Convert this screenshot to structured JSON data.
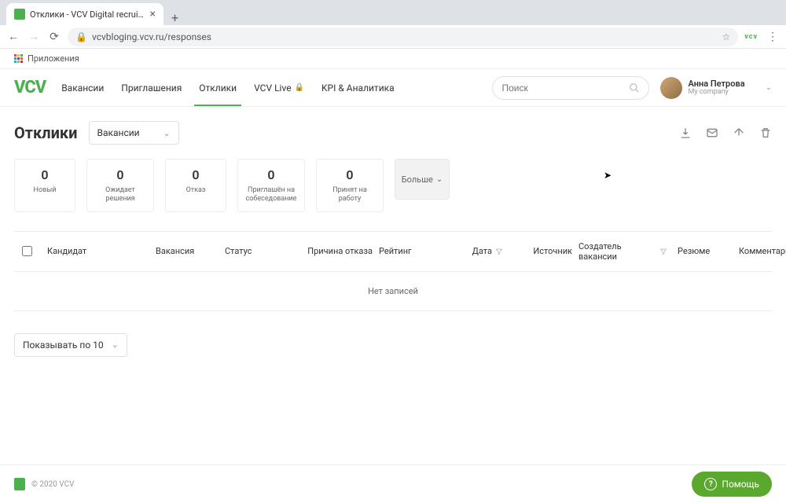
{
  "browser": {
    "tab_title": "Отклики - VCV Digital recruitm",
    "url": "vcvbloging.vcv.ru/responses",
    "bookmarks_label": "Приложения"
  },
  "header": {
    "logo": "VCV",
    "nav": [
      {
        "label": "Вакансии"
      },
      {
        "label": "Приглашения"
      },
      {
        "label": "Отклики",
        "active": true
      },
      {
        "label": "VCV Live",
        "locked": true
      },
      {
        "label": "KPI & Аналитика"
      }
    ],
    "search_placeholder": "Поиск",
    "user": {
      "name": "Анна Петрова",
      "company": "My company"
    }
  },
  "page": {
    "title": "Отклики",
    "filter_dropdown": "Вакансии",
    "actions": {
      "download": "download-icon",
      "mail": "mail-icon",
      "share": "share-icon",
      "delete": "trash-icon"
    },
    "stats": [
      {
        "count": 0,
        "label": "Новый"
      },
      {
        "count": 0,
        "label": "Ожидает решения"
      },
      {
        "count": 0,
        "label": "Отказ"
      },
      {
        "count": 0,
        "label": "Приглашён на собеседование"
      },
      {
        "count": 0,
        "label": "Принят на работу"
      }
    ],
    "more_label": "Больше",
    "table": {
      "columns": {
        "candidate": "Кандидат",
        "vacancy": "Вакансия",
        "status": "Статус",
        "reason": "Причина отказа",
        "rating": "Рейтинг",
        "date": "Дата",
        "source": "Источник",
        "creator": "Создатель вакансии",
        "resume": "Резюме",
        "comments": "Комментарии"
      },
      "empty": "Нет записей"
    },
    "page_size_label": "Показывать по 10"
  },
  "footer": {
    "copyright": "© 2020 VCV",
    "help_label": "Помощь"
  }
}
